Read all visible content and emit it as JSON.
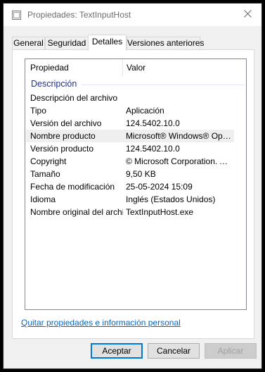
{
  "window": {
    "title": "Propiedades: TextInputHost",
    "icon": "file-icon",
    "close_icon": "close-icon"
  },
  "tabs": [
    {
      "label": "General",
      "active": false
    },
    {
      "label": "Seguridad",
      "active": false
    },
    {
      "label": "Detalles",
      "active": true
    },
    {
      "label": "Versiones anteriores",
      "active": false
    }
  ],
  "details": {
    "columns": {
      "property": "Propiedad",
      "value": "Valor"
    },
    "group_label": "Descripción",
    "rows": [
      {
        "property": "Descripción del archivo",
        "value": ""
      },
      {
        "property": "Tipo",
        "value": "Aplicación"
      },
      {
        "property": "Versión del archivo",
        "value": "124.5402.10.0"
      },
      {
        "property": "Nombre producto",
        "value": "Microsoft® Windows® Opera..."
      },
      {
        "property": "Versión producto",
        "value": "124.5402.10.0"
      },
      {
        "property": "Copyright",
        "value": "© Microsoft Corporation.  All ri..."
      },
      {
        "property": "Tamaño",
        "value": "9,50 KB"
      },
      {
        "property": "Fecha de modificación",
        "value": "25-05-2024 15:09"
      },
      {
        "property": "Idioma",
        "value": "Inglés (Estados Unidos)"
      },
      {
        "property": "Nombre original del archivo",
        "value": "TextInputHost.exe"
      }
    ],
    "selected_row": 3
  },
  "link": {
    "label": "Quitar propiedades e información personal"
  },
  "buttons": {
    "accept": "Aceptar",
    "cancel": "Cancelar",
    "apply": "Aplicar"
  },
  "colors": {
    "group_label": "#1e3287",
    "link": "#0a64bd",
    "accent": "#0078d7"
  }
}
